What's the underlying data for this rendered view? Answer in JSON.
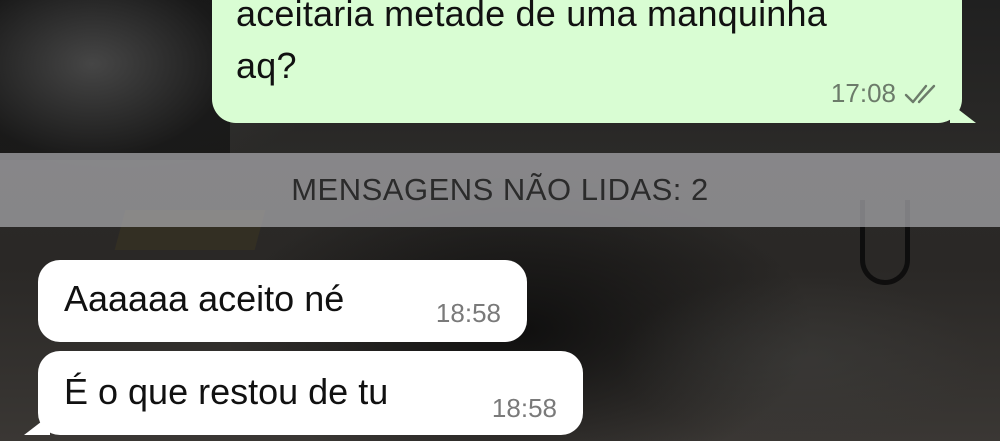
{
  "chat": {
    "outgoing": [
      {
        "text_line1": "aceitaria metade de uma manquinha",
        "text_line2": "aq?",
        "time": "17:08",
        "status_icon": "double-check-icon"
      }
    ],
    "unread_banner": "MENSAGENS NÃO LIDAS: 2",
    "incoming": [
      {
        "text": "Aaaaaa aceito né",
        "time": "18:58"
      },
      {
        "text": "É o que restou de tu",
        "time": "18:58"
      }
    ]
  },
  "colors": {
    "outgoing_bubble": "#d9fdd3",
    "incoming_bubble": "#ffffff",
    "banner": "#aaaaaf"
  }
}
